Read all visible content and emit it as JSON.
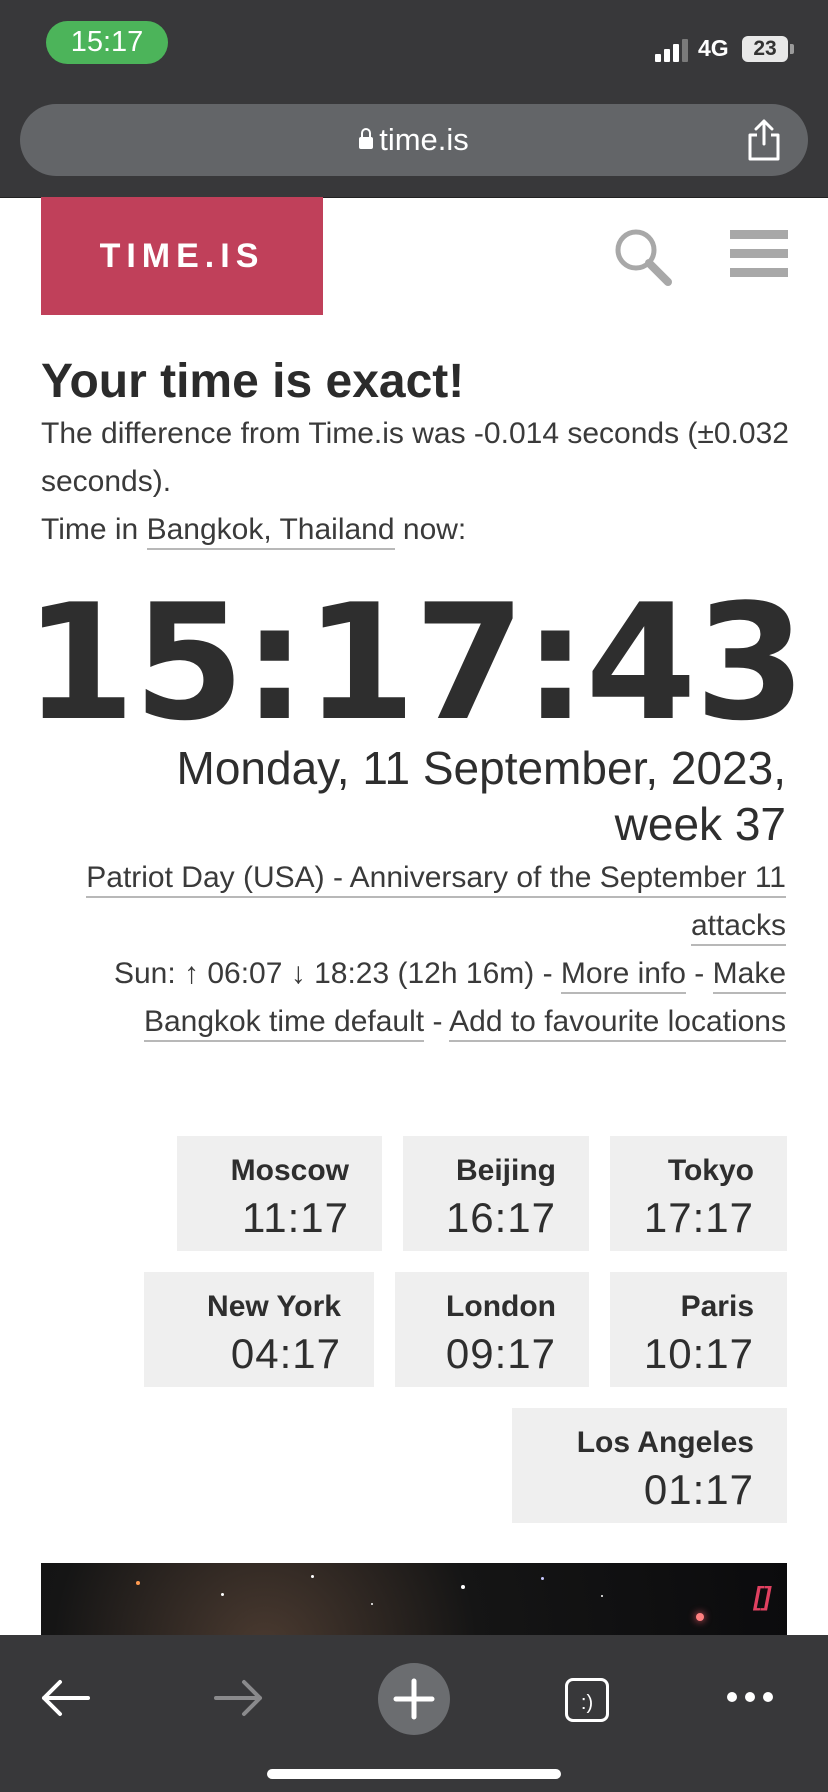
{
  "status_bar": {
    "time": "15:17",
    "network": "4G",
    "battery": "23"
  },
  "browser": {
    "url": "time.is"
  },
  "site": {
    "logo": "TIME.IS"
  },
  "content": {
    "headline": "Your time is exact!",
    "difference": "The difference from Time.is was -0.014 seconds (±0.032 seconds).",
    "location_prefix": "Time in ",
    "location_link": "Bangkok, Thailand",
    "location_suffix": " now:",
    "clock": "15:17:43",
    "date": "Monday, 11 September, 2023,",
    "week": "week 37",
    "holiday_link": "Patriot Day (USA) - Anniversary of the September 11 attacks",
    "sun_info": "Sun: ↑ 06:07 ↓ 18:23 (12h 16m) - ",
    "more_info_link": "More info",
    "sep1": " - ",
    "default_link": "Make Bangkok time default",
    "sep2": " - ",
    "favourite_link": "Add to favourite locations"
  },
  "cities": [
    {
      "name": "Moscow",
      "time": "11:17"
    },
    {
      "name": "Beijing",
      "time": "16:17"
    },
    {
      "name": "Tokyo",
      "time": "17:17"
    },
    {
      "name": "New York",
      "time": "04:17"
    },
    {
      "name": "London",
      "time": "09:17"
    },
    {
      "name": "Paris",
      "time": "10:17"
    },
    {
      "name": "Los Angeles",
      "time": "01:17"
    }
  ],
  "ad": {
    "mark": "[]"
  },
  "toolbar": {
    "tabs_label": ":)"
  },
  "colors": {
    "brand": "#c0405a",
    "chrome": "#38383a",
    "tile": "#efefef",
    "status_green": "#4cb45a"
  }
}
